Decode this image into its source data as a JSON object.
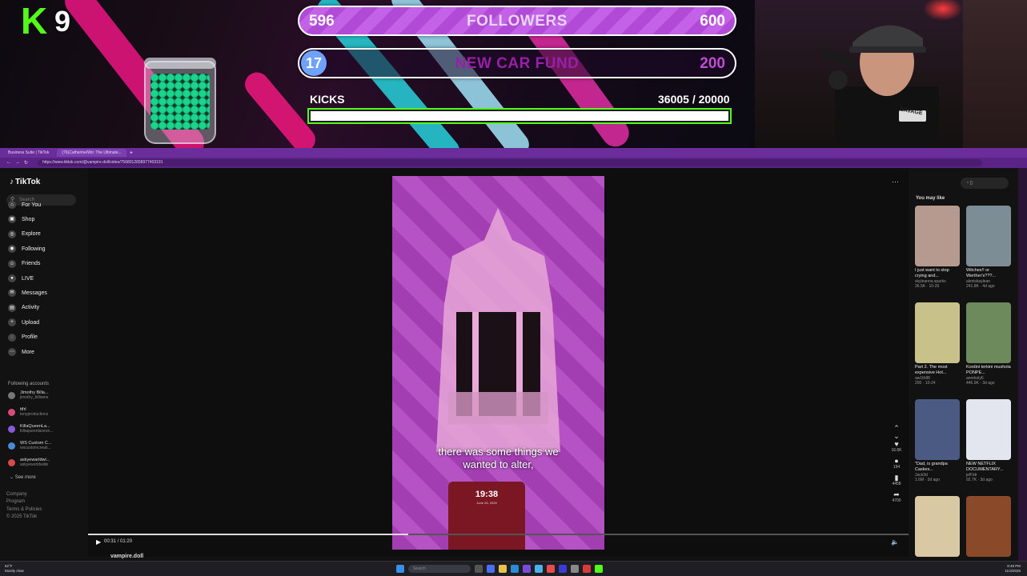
{
  "overlay": {
    "kick_logo": "K",
    "kick_count": "9",
    "goals": {
      "followers": {
        "current": "596",
        "title": "FOLLOWERS",
        "target": "600"
      },
      "car_fund": {
        "current": "17",
        "title": "NEW CAR FUND",
        "target": "200"
      }
    },
    "kicks": {
      "label": "KICKS",
      "value": "36005  / 20000",
      "fill_fraction": 1.0
    },
    "colors": {
      "kick_green": "#53fc18",
      "goal_purple": "#b24ad8"
    }
  },
  "webcam": {
    "hat_patch": "SAVAGE"
  },
  "browser": {
    "tabs": [
      "Business Suite | TikTok",
      "(76)Catherine/Wo: The Ultimate..."
    ],
    "url": "https://www.tiktok.com/@vampire.doll/video/7568012658977403191",
    "nav_icons": [
      "back-icon",
      "forward-icon",
      "reload-icon"
    ]
  },
  "tiktok": {
    "logo": "TikTok",
    "search_placeholder": "Search",
    "nav": [
      {
        "label": "For You",
        "icon": "home-icon"
      },
      {
        "label": "Shop",
        "icon": "shop-icon"
      },
      {
        "label": "Explore",
        "icon": "compass-icon"
      },
      {
        "label": "Following",
        "icon": "following-icon"
      },
      {
        "label": "Friends",
        "icon": "friends-icon"
      },
      {
        "label": "LIVE",
        "icon": "live-icon"
      },
      {
        "label": "Messages",
        "icon": "message-icon"
      },
      {
        "label": "Activity",
        "icon": "inbox-icon"
      },
      {
        "label": "Upload",
        "icon": "upload-icon"
      },
      {
        "label": "Profile",
        "icon": "profile-icon"
      },
      {
        "label": "More",
        "icon": "more-icon"
      }
    ],
    "following_header": "Following accounts",
    "following": [
      {
        "name": "Jimothy Billa...",
        "user": "jimothy_billiams"
      },
      {
        "name": "ttfrl",
        "user": "tonyproductionz"
      },
      {
        "name": "KillaQueenLa...",
        "user": "killaqueenlaveon..."
      },
      {
        "name": "WS Custom C...",
        "user": "wscustomcreati..."
      },
      {
        "name": "askyewarldwi...",
        "user": "askyeworldwide"
      }
    ],
    "see_more": "See more",
    "footer": [
      "Company",
      "Program",
      "Terms & Policies",
      "© 2025 TikTok"
    ],
    "video": {
      "caption_line1": "there was some things we",
      "caption_line2": "wanted to alter,",
      "phone_time": "19:38",
      "phone_date": "June 26, 2025",
      "timecode": "00:31 / 01:20",
      "progress_fraction": 0.39,
      "author": "vampire.doll"
    },
    "actions": [
      {
        "icon": "heart-icon",
        "count": "16.6K"
      },
      {
        "icon": "comment-icon",
        "count": "194"
      },
      {
        "icon": "bookmark-icon",
        "count": "4458"
      },
      {
        "icon": "share-icon",
        "count": "4700"
      }
    ],
    "you_may_like": "You may like",
    "recommended": [
      {
        "title": "I just want to stop crying and...",
        "user": "skyleanna.sparks",
        "meta": "36.5K · 10-26",
        "color": "#b79a8f"
      },
      {
        "title": "Witches!! or Werther's???...",
        "user": "alexiskaylean",
        "meta": "241.8K · 4d ago",
        "color": "#7d8d96"
      },
      {
        "title": "Part 2. The most expensive Hot...",
        "user": "aw1th88",
        "meta": "200 · 10-24",
        "color": "#c8c28a"
      },
      {
        "title": "Kordini terkini mushola PONPE...",
        "user": "anorkoly6",
        "meta": "446.9K · 3d ago",
        "color": "#6c8a5c"
      },
      {
        "title": "\"Dad, is grandpa Caskes...",
        "user": "Jack3d",
        "meta": "1.6M · 3d ago",
        "color": "#4a5a82"
      },
      {
        "title": "NEW NETFLIX DOCUMENTARY...",
        "user": "jeff.ldr",
        "meta": "92.7K · 3d ago",
        "color": "#e3e6ee"
      },
      {
        "title": "",
        "user": "",
        "meta": "",
        "color": "#d8c8a4"
      },
      {
        "title": "",
        "user": "",
        "meta": "",
        "color": "#8a4a2a"
      }
    ]
  },
  "taskbar": {
    "weather_temp": "52°F",
    "weather_desc": "Mostly clear",
    "search_placeholder": "Search",
    "time": "8:48 PM",
    "date": "11/3/2025"
  }
}
